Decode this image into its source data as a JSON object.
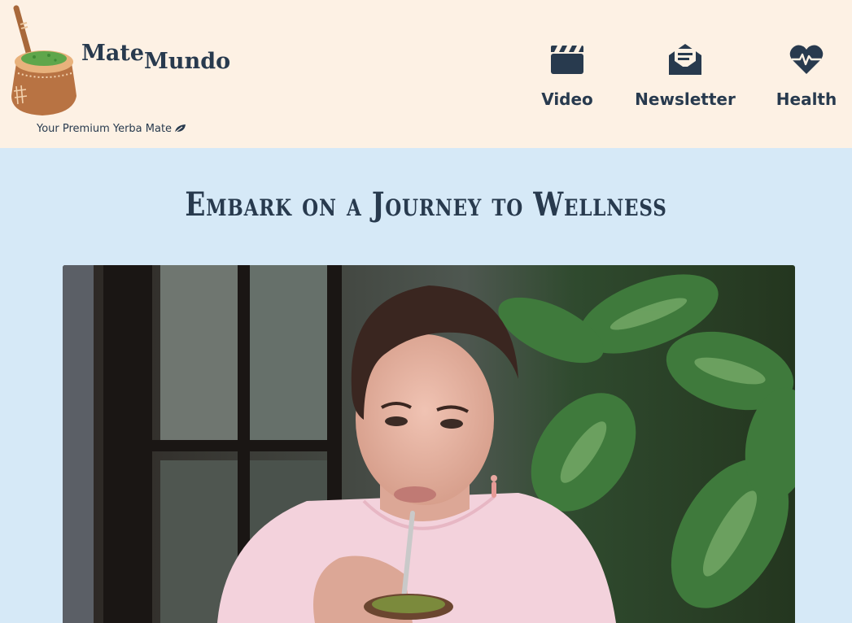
{
  "brand": {
    "word1": "Mate",
    "word2": "Mundo",
    "tagline": "Your Premium Yerba Mate"
  },
  "nav": {
    "items": [
      {
        "label": "Video",
        "icon": "clapperboard-icon"
      },
      {
        "label": "Newsletter",
        "icon": "envelope-newsletter-icon"
      },
      {
        "label": "Health",
        "icon": "heart-pulse-icon"
      }
    ]
  },
  "main": {
    "title": "Embark on a Journey to Wellness"
  },
  "colors": {
    "header_bg": "#fdf1e4",
    "page_bg": "#d6e9f7",
    "text_dark": "#283a4e",
    "gourd_brown": "#b87343",
    "yerba_green": "#5fa64b"
  }
}
